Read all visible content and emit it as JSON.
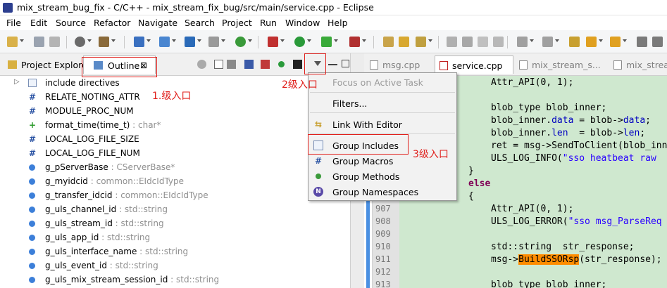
{
  "window": {
    "title": "mix_stream_bug_fix - C/C++ - mix_stream_fix_bug/src/main/service.cpp - Eclipse"
  },
  "menu": [
    "File",
    "Edit",
    "Source",
    "Refactor",
    "Navigate",
    "Search",
    "Project",
    "Run",
    "Window",
    "Help"
  ],
  "view_tabs": {
    "project_explorer": "Project Explorer",
    "outline": "Outline",
    "close_glyph": "⊠"
  },
  "outline_items": [
    {
      "name": "include directives",
      "type": "",
      "icon": "include-icon"
    },
    {
      "name": "RELATE_NOTING_ATTR",
      "type": "",
      "icon": "macro-icon"
    },
    {
      "name": "MODULE_PROC_NUM",
      "type": "",
      "icon": "macro-icon"
    },
    {
      "name": "format_time(time_t)",
      "type": " : char*",
      "icon": "function-icon"
    },
    {
      "name": "LOCAL_LOG_FILE_SIZE",
      "type": "",
      "icon": "macro-icon"
    },
    {
      "name": "LOCAL_LOG_FILE_NUM",
      "type": "",
      "icon": "macro-icon"
    },
    {
      "name": "g_pServerBase",
      "type": " : CServerBase*",
      "icon": "variable-icon"
    },
    {
      "name": "g_myidcid",
      "type": " : common::EIdcIdType",
      "icon": "variable-icon"
    },
    {
      "name": "g_transfer_idcid",
      "type": " : common::EIdcIdType",
      "icon": "variable-icon"
    },
    {
      "name": "g_uls_channel_id",
      "type": " : std::string",
      "icon": "variable-icon"
    },
    {
      "name": "g_uls_stream_id",
      "type": " : std::string",
      "icon": "variable-icon"
    },
    {
      "name": "g_uls_app_id",
      "type": " : std::string",
      "icon": "variable-icon"
    },
    {
      "name": "g_uls_interface_name",
      "type": " : std::string",
      "icon": "variable-icon"
    },
    {
      "name": "g_uls_event_id",
      "type": " : std::string",
      "icon": "variable-icon"
    },
    {
      "name": "g_uls_mix_stream_session_id",
      "type": " : std::string",
      "icon": "variable-icon"
    }
  ],
  "editor_tabs": [
    {
      "label": "msg.cpp",
      "active": false
    },
    {
      "label": "service.cpp",
      "active": true
    },
    {
      "label": "mix_stream_s...",
      "active": false
    },
    {
      "label": "mix_stream...",
      "active": false
    }
  ],
  "line_numbers": [
    "907",
    "908",
    "909",
    "910",
    "911",
    "912",
    "913"
  ],
  "code": {
    "l0": "Attr_API(0, 1);",
    "l2a": "blob_type",
    "l2b": " blob_inner;",
    "l3a": "blob_inner.",
    "l3b": "data",
    "l3c": " = blob->",
    "l3d": "data",
    "l3e": ";",
    "l4a": "blob_inner.",
    "l4b": "len",
    "l4c": "  = blob->",
    "l4d": "len",
    "l4e": ";",
    "l5": "ret = msg->SendToClient(blob_inn",
    "l6a": "ULS_LOG_INFO(",
    "l6b": "\"sso heatbeat raw",
    "l7": "}",
    "l8": "else",
    "l9": "{",
    "l10": "Attr_API(0, 1);",
    "l11a": "ULS_LOG_ERROR(",
    "l11b": "\"sso msg_ParseReq",
    "l13": "std::string  str_response;",
    "l14a": "msg->",
    "l14b": "BuildSSORsp",
    "l14c": "(str_response);",
    "l16a": "blob_type",
    "l16b": " blob_inner;"
  },
  "dropdown": {
    "focus_active_task": "Focus on Active Task",
    "filters": "Filters...",
    "link_with_editor": "Link With Editor",
    "group_includes": "Group Includes",
    "group_macros": "Group Macros",
    "group_methods": "Group Methods",
    "group_namespaces": "Group Namespaces"
  },
  "annotations": {
    "level1": "1.级入口",
    "level2": "2级入口",
    "level3": "3级入口"
  },
  "colors": {
    "annotation_red": "#e0201c",
    "code_bg": "#cfe8cf",
    "highlight": "#ff8c00"
  }
}
